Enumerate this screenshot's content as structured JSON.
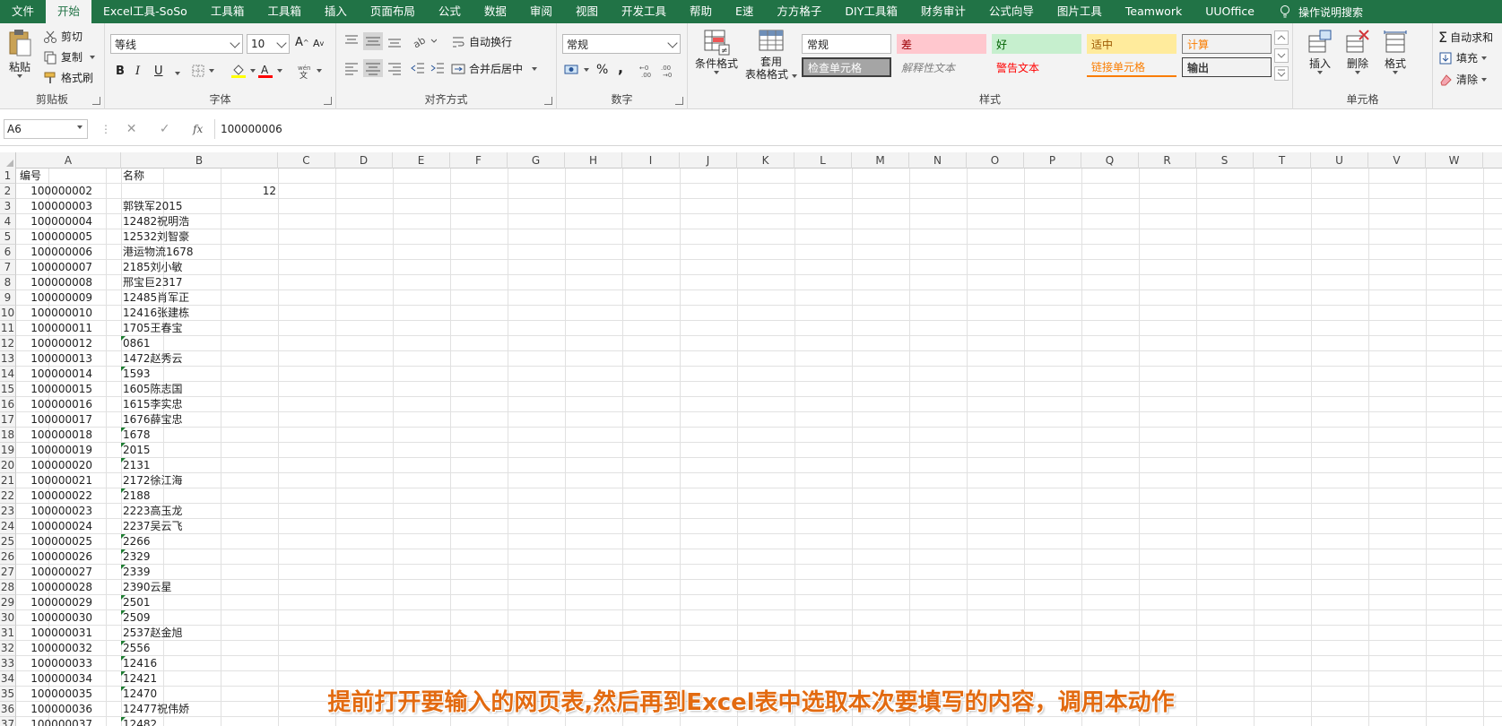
{
  "tabs": [
    "文件",
    "开始",
    "Excel工具-SoSo",
    "工具箱",
    "工具箱",
    "插入",
    "页面布局",
    "公式",
    "数据",
    "审阅",
    "视图",
    "开发工具",
    "帮助",
    "E速",
    "方方格子",
    "DIY工具箱",
    "财务审计",
    "公式向导",
    "图片工具",
    "Teamwork",
    "UUOffice"
  ],
  "tell_me": "操作说明搜索",
  "clipboard": {
    "label": "剪贴板",
    "paste": "粘贴",
    "cut": "剪切",
    "copy": "复制",
    "format_painter": "格式刷"
  },
  "font": {
    "label": "字体",
    "name": "等线",
    "size": "10",
    "bold": "B",
    "italic": "I",
    "underline": "U"
  },
  "alignment": {
    "label": "对齐方式",
    "wrap": "自动换行",
    "merge": "合并后居中"
  },
  "number": {
    "label": "数字",
    "format": "常规",
    "percent": "%",
    "comma": ","
  },
  "styles": {
    "label": "样式",
    "conditional": "条件格式",
    "table_format_1": "套用",
    "table_format_2": "表格格式",
    "cells": [
      {
        "text": "常规",
        "bg": "#ffffff",
        "fg": "#222222"
      },
      {
        "text": "差",
        "bg": "#ffc7ce",
        "fg": "#9c0006"
      },
      {
        "text": "好",
        "bg": "#c6efce",
        "fg": "#006100"
      },
      {
        "text": "适中",
        "bg": "#ffeb9c",
        "fg": "#9c5700"
      },
      {
        "text": "计算",
        "bg": "#f2f2f2",
        "fg": "#fa7d00"
      },
      {
        "text": "检查单元格",
        "bg": "#a5a5a5",
        "fg": "#ffffff"
      },
      {
        "text": "解释性文本",
        "bg": "#f3f3f3",
        "fg": "#7f7f7f"
      },
      {
        "text": "警告文本",
        "bg": "#f3f3f3",
        "fg": "#ff0000"
      },
      {
        "text": "链接单元格",
        "bg": "#f3f3f3",
        "fg": "#fa7d00"
      },
      {
        "text": "输出",
        "bg": "#f2f2f2",
        "fg": "#3f3f3f"
      }
    ]
  },
  "cells_group": {
    "label": "单元格",
    "insert": "插入",
    "delete": "删除",
    "format": "格式"
  },
  "editing": {
    "autosum": "自动求和",
    "fill": "填充",
    "clear": "清除"
  },
  "name_box": "A6",
  "formula_value": "100000006",
  "columns": [
    "A",
    "B",
    "C",
    "D",
    "E",
    "F",
    "G",
    "H",
    "I",
    "J",
    "K",
    "L",
    "M",
    "N",
    "O",
    "P",
    "Q",
    "R",
    "S",
    "T",
    "U",
    "V",
    "W"
  ],
  "rows": [
    {
      "n": "1",
      "a": "编号",
      "b": "名称",
      "a_num": false,
      "b_num": false,
      "tri": false
    },
    {
      "n": "2",
      "a": "100000002",
      "b": "12",
      "b_num": true,
      "tri": false
    },
    {
      "n": "3",
      "a": "100000003",
      "b": "郭铁军2015",
      "tri": false
    },
    {
      "n": "4",
      "a": "100000004",
      "b": "12482祝明浩",
      "tri": false
    },
    {
      "n": "5",
      "a": "100000005",
      "b": "12532刘智豪",
      "tri": false
    },
    {
      "n": "6",
      "a": "100000006",
      "b": "港运物流1678",
      "tri": false
    },
    {
      "n": "7",
      "a": "100000007",
      "b": "2185刘小敏",
      "tri": false
    },
    {
      "n": "8",
      "a": "100000008",
      "b": "邢宝巨2317",
      "tri": false
    },
    {
      "n": "9",
      "a": "100000009",
      "b": "12485肖军正",
      "tri": false
    },
    {
      "n": "10",
      "a": "100000010",
      "b": "12416张建栋",
      "tri": false
    },
    {
      "n": "11",
      "a": "100000011",
      "b": "1705王春宝",
      "tri": false
    },
    {
      "n": "12",
      "a": "100000012",
      "b": "0861",
      "tri": true
    },
    {
      "n": "13",
      "a": "100000013",
      "b": "1472赵秀云",
      "tri": false
    },
    {
      "n": "14",
      "a": "100000014",
      "b": "1593",
      "tri": true
    },
    {
      "n": "15",
      "a": "100000015",
      "b": "1605陈志国",
      "tri": false
    },
    {
      "n": "16",
      "a": "100000016",
      "b": "1615李实忠",
      "tri": false
    },
    {
      "n": "17",
      "a": "100000017",
      "b": "1676薛宝忠",
      "tri": false
    },
    {
      "n": "18",
      "a": "100000018",
      "b": "1678",
      "tri": true
    },
    {
      "n": "19",
      "a": "100000019",
      "b": "2015",
      "tri": true
    },
    {
      "n": "20",
      "a": "100000020",
      "b": "2131",
      "tri": true
    },
    {
      "n": "21",
      "a": "100000021",
      "b": "2172徐江海",
      "tri": false
    },
    {
      "n": "22",
      "a": "100000022",
      "b": "2188",
      "tri": true
    },
    {
      "n": "23",
      "a": "100000023",
      "b": "2223高玉龙",
      "tri": false
    },
    {
      "n": "24",
      "a": "100000024",
      "b": "2237吴云飞",
      "tri": false
    },
    {
      "n": "25",
      "a": "100000025",
      "b": "2266",
      "tri": true
    },
    {
      "n": "26",
      "a": "100000026",
      "b": "2329",
      "tri": true
    },
    {
      "n": "27",
      "a": "100000027",
      "b": "2339",
      "tri": true
    },
    {
      "n": "28",
      "a": "100000028",
      "b": "2390云星",
      "tri": false
    },
    {
      "n": "29",
      "a": "100000029",
      "b": "2501",
      "tri": true
    },
    {
      "n": "30",
      "a": "100000030",
      "b": "2509",
      "tri": true
    },
    {
      "n": "31",
      "a": "100000031",
      "b": "2537赵金旭",
      "tri": false
    },
    {
      "n": "32",
      "a": "100000032",
      "b": "2556",
      "tri": true
    },
    {
      "n": "33",
      "a": "100000033",
      "b": "12416",
      "tri": true
    },
    {
      "n": "34",
      "a": "100000034",
      "b": "12421",
      "tri": true
    },
    {
      "n": "35",
      "a": "100000035",
      "b": "12470",
      "tri": true
    },
    {
      "n": "36",
      "a": "100000036",
      "b": "12477祝伟娇",
      "tri": false
    },
    {
      "n": "37",
      "a": "100000037",
      "b": "12482",
      "tri": true
    }
  ],
  "subtitle": "提前打开要输入的网页表,然后再到Excel表中选取本次要填写的内容，调用本动作"
}
